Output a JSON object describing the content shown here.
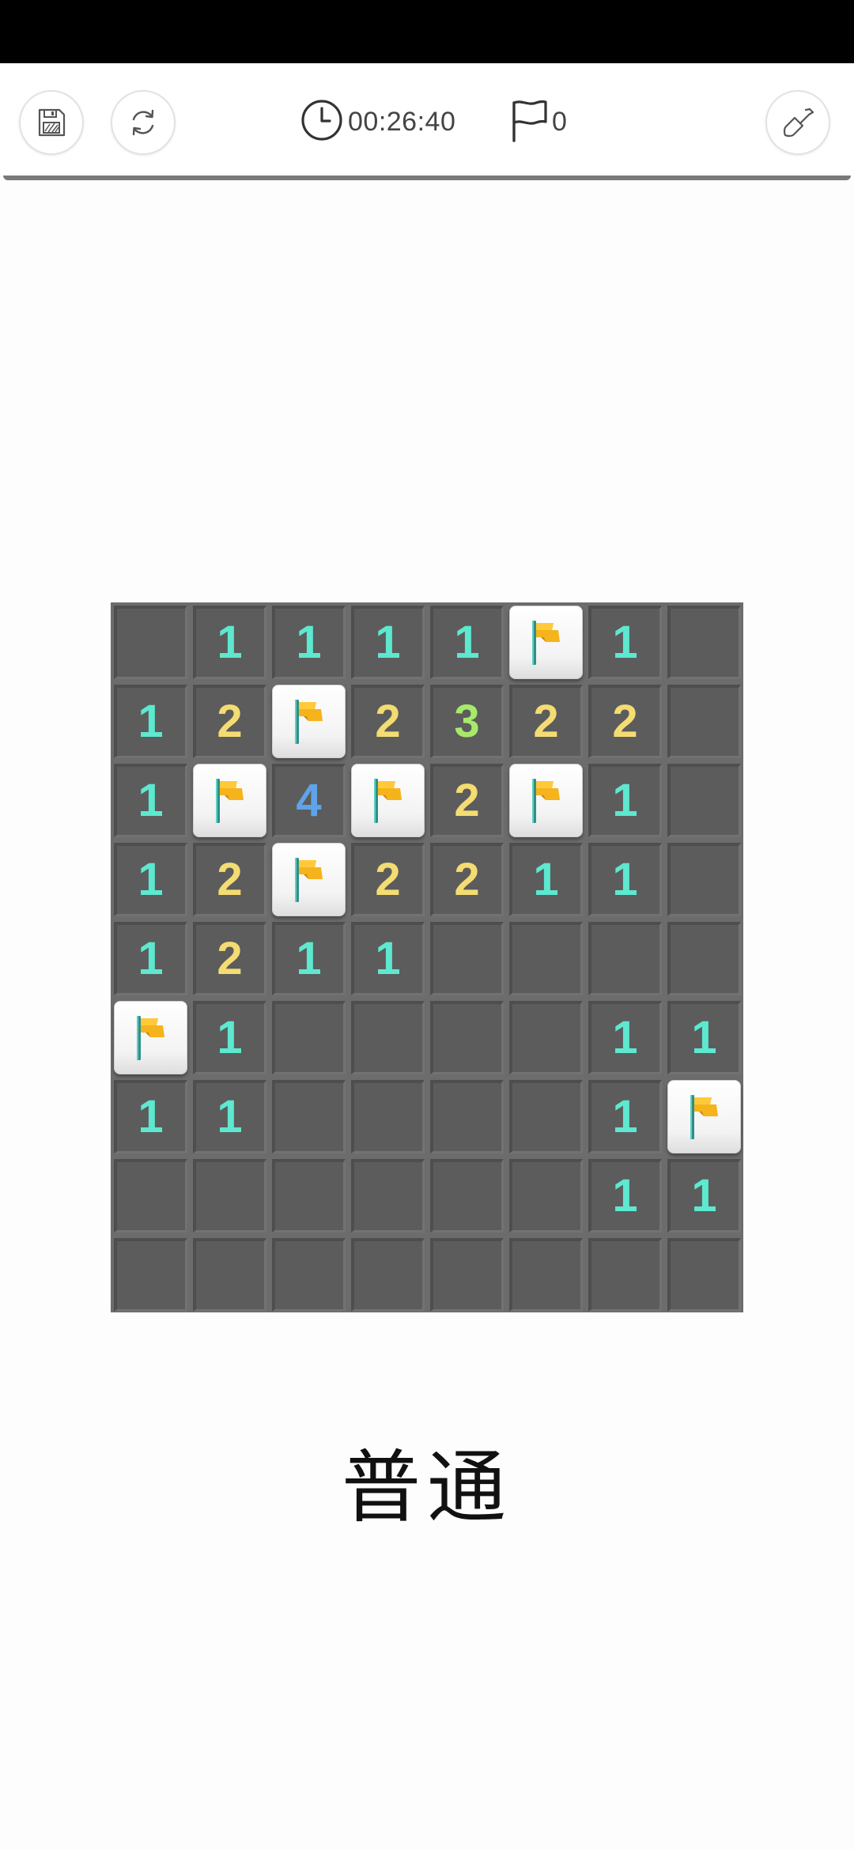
{
  "toolbar": {
    "timer": "00:26:40",
    "flag_count": "0",
    "icons": [
      "save-icon",
      "restart-icon",
      "clock-icon",
      "flag-icon",
      "shovel-icon"
    ]
  },
  "board": {
    "rows": 9,
    "cols": 8,
    "cells": [
      [
        "",
        "1",
        "1",
        "1",
        "1",
        "F",
        "1",
        ""
      ],
      [
        "1",
        "2",
        "F",
        "2",
        "3",
        "2",
        "2",
        ""
      ],
      [
        "1",
        "F",
        "4",
        "F",
        "2",
        "F",
        "1",
        ""
      ],
      [
        "1",
        "2",
        "F",
        "2",
        "2",
        "1",
        "1",
        ""
      ],
      [
        "1",
        "2",
        "1",
        "1",
        "",
        "",
        "",
        ""
      ],
      [
        "F",
        "1",
        "",
        "",
        "",
        "",
        "1",
        "1"
      ],
      [
        "1",
        "1",
        "",
        "",
        "",
        "",
        "1",
        "F"
      ],
      [
        "",
        "",
        "",
        "",
        "",
        "",
        "1",
        "1"
      ],
      [
        "",
        "",
        "",
        "",
        "",
        "",
        "",
        ""
      ]
    ],
    "number_colors": {
      "1": "#5de8cf",
      "2": "#f4dc72",
      "3": "#a6ea6a",
      "4": "#5fa3ea"
    },
    "flag_color": "#f5b31c"
  },
  "difficulty_label": "普通"
}
